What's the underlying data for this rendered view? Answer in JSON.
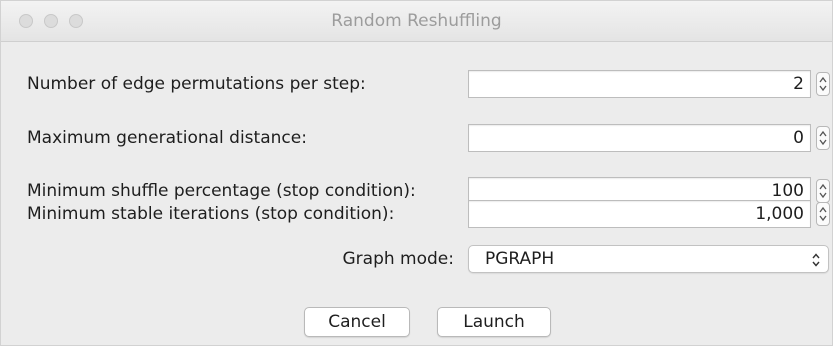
{
  "window": {
    "title": "Random Reshuffling",
    "controls": [
      "close-icon",
      "minimize-icon",
      "zoom-icon"
    ]
  },
  "form": {
    "fields": [
      {
        "label": "Number of edge permutations per step:",
        "value": "2"
      },
      {
        "label": "Maximum generational distance:",
        "value": "0"
      },
      {
        "label": "Minimum shuffle percentage (stop condition):",
        "value": "100"
      },
      {
        "label": "Minimum stable iterations (stop condition):",
        "value": "1,000"
      }
    ],
    "graph_mode": {
      "label": "Graph mode:",
      "selected": "PGRAPH"
    }
  },
  "buttons": {
    "cancel": "Cancel",
    "launch": "Launch"
  }
}
